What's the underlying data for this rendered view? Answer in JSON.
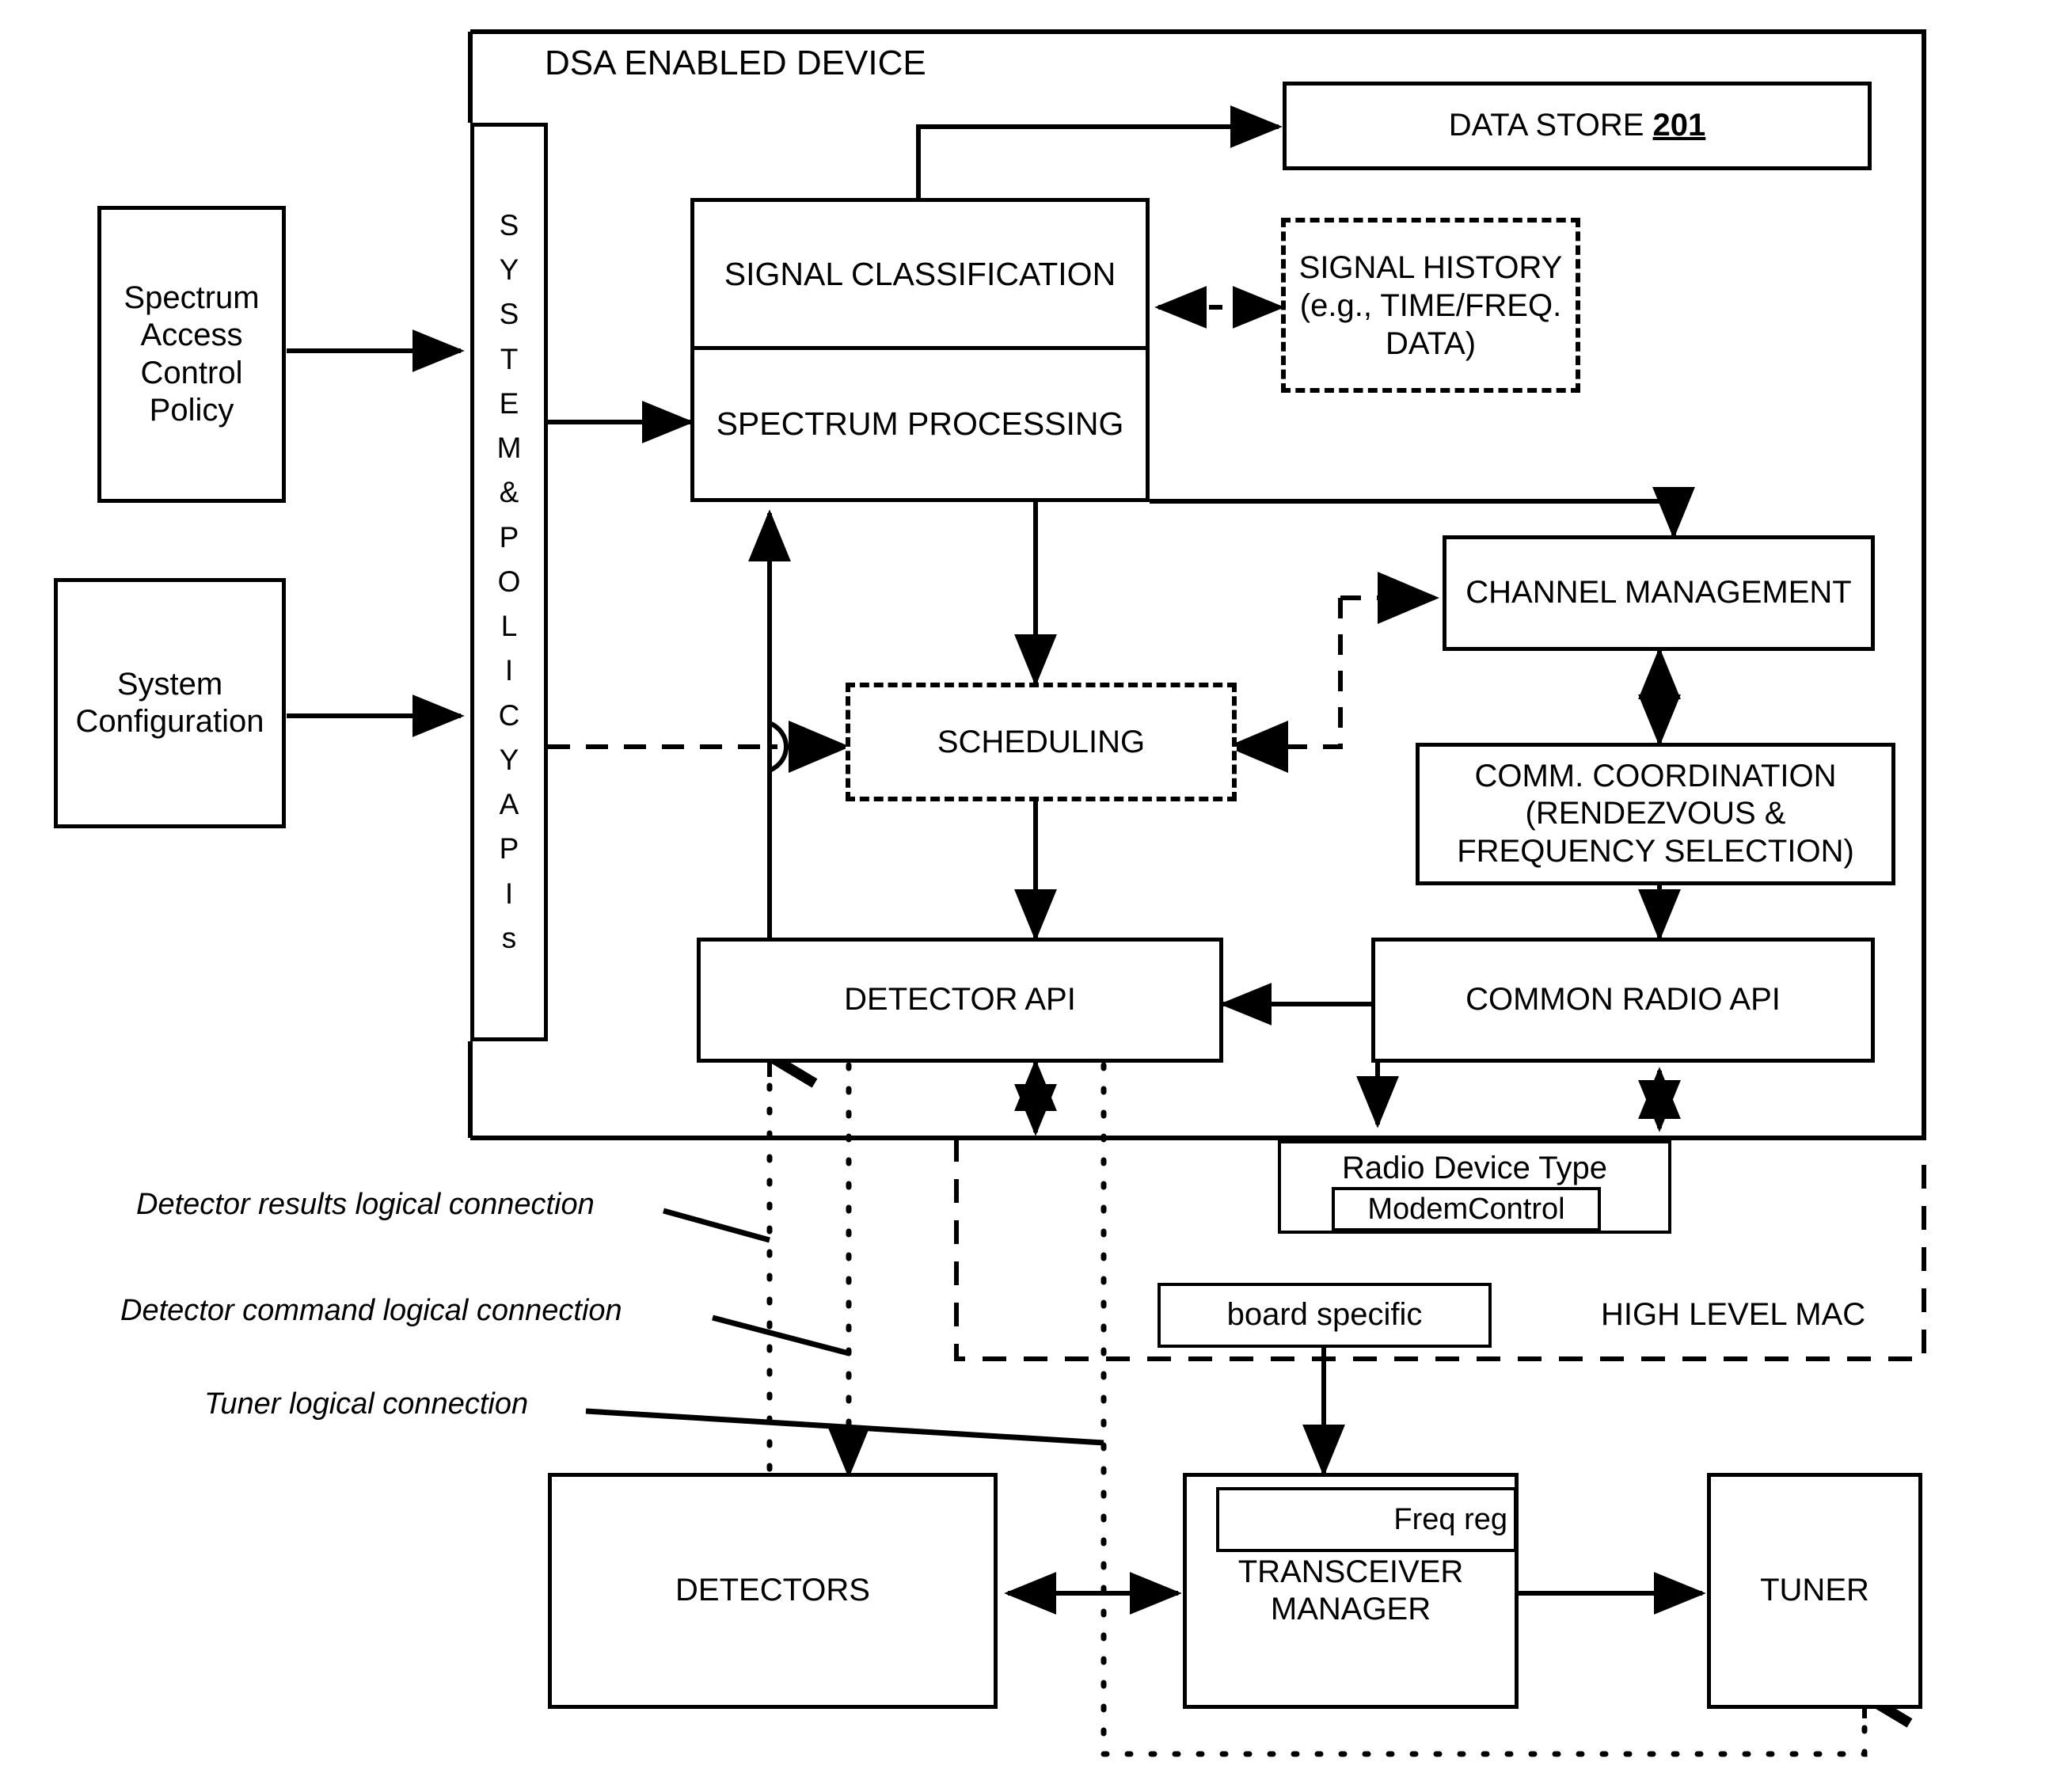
{
  "diagram": {
    "device_frame_title": "DSA ENABLED DEVICE",
    "api_column_letters": [
      "S",
      "Y",
      "S",
      "T",
      "E",
      "M",
      "",
      "&",
      "",
      "P",
      "O",
      "L",
      "I",
      "C",
      "Y",
      "",
      "A",
      "P",
      "I",
      "s"
    ],
    "api_column_text": "SYSTEM & POLICY APIs",
    "high_level_mac_label": "HIGH LEVEL MAC"
  },
  "boxes": {
    "spectrum_access_control_policy": "Spectrum\nAccess\nControl\nPolicy",
    "system_configuration": "System\nConfiguration",
    "signal_classification": "SIGNAL CLASSIFICATION",
    "spectrum_processing": "SPECTRUM PROCESSING",
    "data_store": "DATA STORE ",
    "data_store_ref": "201",
    "signal_history": "SIGNAL HISTORY (e.g., TIME/FREQ. DATA)",
    "channel_management": "CHANNEL MANAGEMENT",
    "comm_coordination": "COMM. COORDINATION (RENDEZVOUS & FREQUENCY SELECTION)",
    "scheduling": "SCHEDULING",
    "detector_api": "DETECTOR API",
    "common_radio_api": "COMMON RADIO API",
    "radio_device_type": "Radio Device Type",
    "modem_control": "ModemControl",
    "board_specific": "board specific",
    "detectors": "DETECTORS",
    "transceiver_manager": "TRANSCEIVER MANAGER",
    "freq_reg": "Freq reg",
    "tuner": "TUNER"
  },
  "legend": {
    "detector_results": "Detector results logical connection",
    "detector_command": "Detector command logical connection",
    "tuner_connection": "Tuner logical connection"
  },
  "colors": {
    "line": "#000000",
    "background": "#ffffff"
  }
}
